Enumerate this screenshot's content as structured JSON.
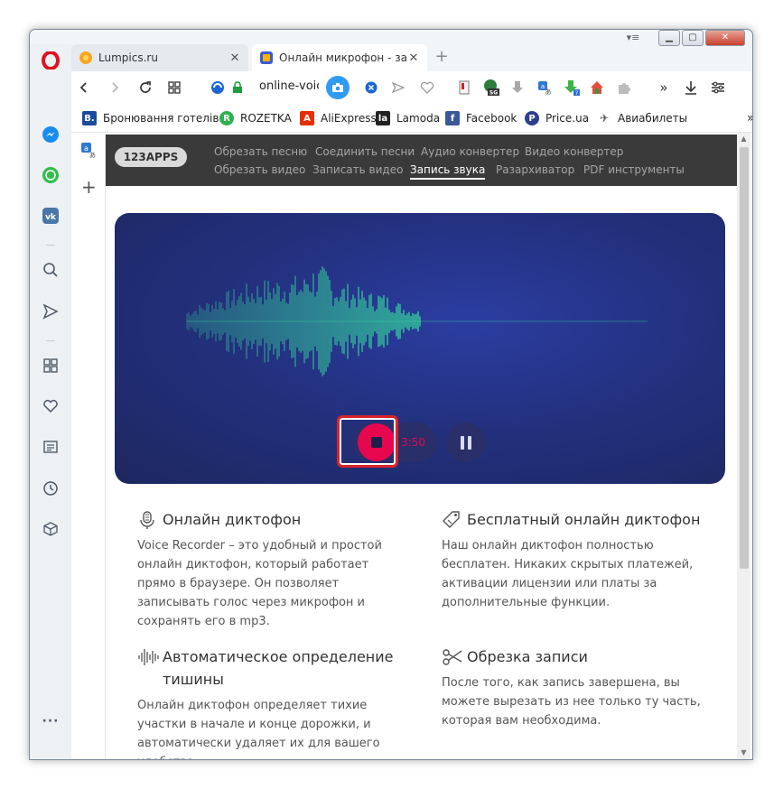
{
  "browser": {
    "tabs": [
      {
        "title": "Lumpics.ru",
        "favicon": "orange-flower-icon"
      },
      {
        "title": "Онлайн микрофон - запис",
        "favicon": "123apps-icon"
      }
    ],
    "address": "online-voic",
    "bookmarks": [
      {
        "label": "Бронювання готелів",
        "icon": "B.",
        "color": "#1a4b9c"
      },
      {
        "label": "ROZETKA",
        "icon": "R",
        "color": "#2bb24c"
      },
      {
        "label": "AliExpress",
        "icon": "A",
        "color": "#e62e04"
      },
      {
        "label": "Lamoda",
        "icon": "la",
        "color": "#222222"
      },
      {
        "label": "Facebook",
        "icon": "f",
        "color": "#3b5998"
      },
      {
        "label": "Price.ua",
        "icon": "P",
        "color": "#2e3f8f"
      },
      {
        "label": "Авиабилеты",
        "icon": "✈",
        "color": "#5a5a5a"
      }
    ]
  },
  "site": {
    "logo": "123APPS",
    "nav_row1": [
      "Обрезать песню",
      "Соединить песни",
      "Аудио конвертер",
      "Видео конвертер"
    ],
    "nav_row2": [
      "Обрезать видео",
      "Записать видео",
      "Запись звука",
      "Разархиватор",
      "PDF инструменты"
    ],
    "active_nav": "Запись звука"
  },
  "recorder": {
    "timer": "3:50"
  },
  "features": [
    {
      "title": "Онлайн диктофон",
      "text": "Voice Recorder – это удобный и простой онлайн диктофон, который работает прямо в браузере. Он позволяет записывать голос через микрофон и сохранять его в mp3."
    },
    {
      "title": "Бесплатный онлайн диктофон",
      "text": "Наш онлайн диктофон полностью бесплатен. Никаких скрытых платежей, активации лицензии или платы за дополнительные функции."
    },
    {
      "title": "Автоматическое определение тишины",
      "text": "Онлайн диктофон определяет тихие участки в начале и конце дорожки, и автоматически удаляет их для вашего удобства."
    },
    {
      "title": "Обрезка записи",
      "text": "После того, как запись завершена, вы можете вырезать из нее только ту часть, которая вам необходима."
    }
  ],
  "colors": {
    "accent": "#e6074f",
    "hero_bg": "#23317f",
    "wave": "#35d49a",
    "highlight": "#d9232b"
  }
}
